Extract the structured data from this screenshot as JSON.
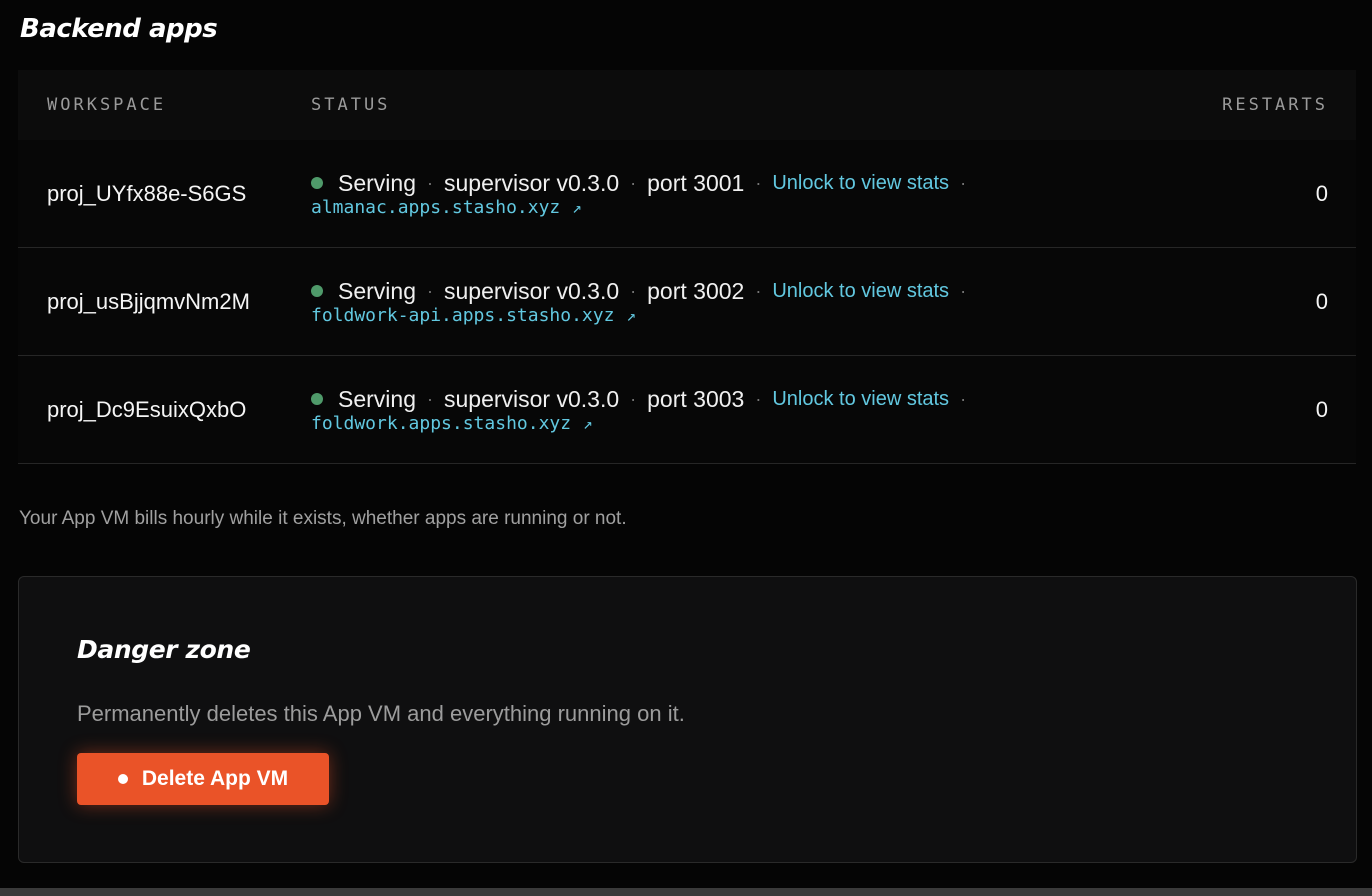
{
  "section": {
    "title": "Backend apps"
  },
  "table": {
    "columns": {
      "workspace": "WORKSPACE",
      "status": "STATUS",
      "restarts": "RESTARTS"
    },
    "rows": [
      {
        "workspace": "proj_UYfx88e-S6GS",
        "status": "Serving",
        "supervisor": "supervisor v0.3.0",
        "port": "port 3001",
        "stats_link": "Unlock to view stats",
        "url": "almanac.apps.stasho.xyz",
        "restarts": "0"
      },
      {
        "workspace": "proj_usBjjqmvNm2M",
        "status": "Serving",
        "supervisor": "supervisor v0.3.0",
        "port": "port 3002",
        "stats_link": "Unlock to view stats",
        "url": "foldwork-api.apps.stasho.xyz",
        "restarts": "0"
      },
      {
        "workspace": "proj_Dc9EsuixQxbO",
        "status": "Serving",
        "supervisor": "supervisor v0.3.0",
        "port": "port 3003",
        "stats_link": "Unlock to view stats",
        "url": "foldwork.apps.stasho.xyz",
        "restarts": "0"
      }
    ],
    "separator": "·",
    "external_icon": "↗"
  },
  "billing_note": "Your App VM bills hourly while it exists, whether apps are running or not.",
  "danger_zone": {
    "title": "Danger zone",
    "description": "Permanently deletes this App VM and everything running on it.",
    "delete_label": "Delete App VM"
  },
  "colors": {
    "accent_link": "#62c8e0",
    "status_ok": "#4f9a6a",
    "danger": "#ea5328"
  }
}
